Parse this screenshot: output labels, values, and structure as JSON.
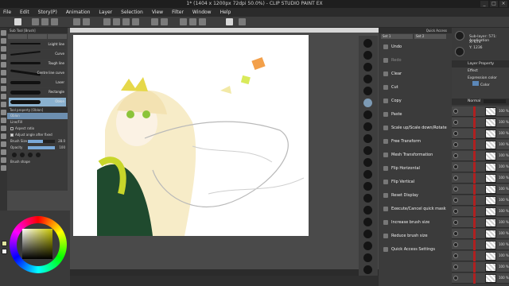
{
  "window": {
    "title": "1* (1404 x 1200px 72dpi 50.0%) - CLIP STUDIO PAINT EX",
    "min_label": "_",
    "max_label": "□",
    "close_label": "×"
  },
  "menu": [
    "File",
    "Edit",
    "Story(P)",
    "Animation",
    "Layer",
    "Selection",
    "View",
    "Filter",
    "Window",
    "Help"
  ],
  "subtool": {
    "panel_title": "Sub Tool [Brush]",
    "tabs": [
      "",
      "",
      ""
    ],
    "brushes": [
      {
        "name": "Lsight line",
        "selected": false
      },
      {
        "name": "Curve",
        "selected": false
      },
      {
        "name": "Tough line",
        "selected": false
      },
      {
        "name": "Centre line curve",
        "selected": false
      },
      {
        "name": "Laser",
        "selected": false
      },
      {
        "name": "Rectangle",
        "selected": false
      },
      {
        "name": "Oblon",
        "selected": true
      }
    ]
  },
  "toolprop": {
    "panel_title": "Tool property [Oblon]",
    "tool_name": "Oblon",
    "line_fill": "Line/Fill",
    "aspect_label": "Aspect ratio",
    "adjust_label": "Adjust angle after fixed",
    "brush_size_label": "Brush Size",
    "brush_size_value": "28.0",
    "brush_size_fraction": 0.55,
    "opacity_label": "Opacity",
    "opacity_value": "100",
    "opacity_fraction": 1,
    "brush_shape_label": "Brush shape"
  },
  "color": {
    "main": "#e2e6a0",
    "sub": "#f2f2f2"
  },
  "quick_access": {
    "panel_title": "Quick Access",
    "tabs": [
      "Set 1",
      "Set 2"
    ],
    "items": [
      {
        "label": "Undo",
        "enabled": true
      },
      {
        "label": "Redo",
        "enabled": false
      },
      {
        "label": "Clear",
        "enabled": true
      },
      {
        "label": "Cut",
        "enabled": true
      },
      {
        "label": "Copy",
        "enabled": true
      },
      {
        "label": "Paste",
        "enabled": true
      },
      {
        "label": "Scale up/Scale down/Rotate",
        "enabled": true
      },
      {
        "label": "Free Transform",
        "enabled": true
      },
      {
        "label": "Mesh Transformation",
        "enabled": true
      },
      {
        "label": "Flip Horizontal",
        "enabled": true
      },
      {
        "label": "Flip Vertical",
        "enabled": true
      },
      {
        "label": "Reset Display",
        "enabled": true
      },
      {
        "label": "Execute/Cancel quick mask",
        "enabled": true
      },
      {
        "label": "Increase brush size",
        "enabled": true
      },
      {
        "label": "Reduce brush size",
        "enabled": true
      },
      {
        "label": "Quick Access Settings",
        "enabled": true
      }
    ]
  },
  "navigator": {
    "rows": [
      "Sub-layer: 571: Application",
      "X: 674",
      "Y: 1236"
    ]
  },
  "layer_property": {
    "panel_title": "Layer Property",
    "effect_label": "Effect",
    "expression_color_label": "Expression color",
    "color_label": "Color"
  },
  "layers": {
    "panel_title": "Normal",
    "rows": [
      "100 %",
      "100 %",
      "100 %",
      "100 %",
      "100 %",
      "100 %",
      "100 %",
      "100 %",
      "100 %",
      "100 %",
      "100 %",
      "100 %",
      "100 %",
      "100 %",
      "100 %",
      "100 %"
    ]
  }
}
